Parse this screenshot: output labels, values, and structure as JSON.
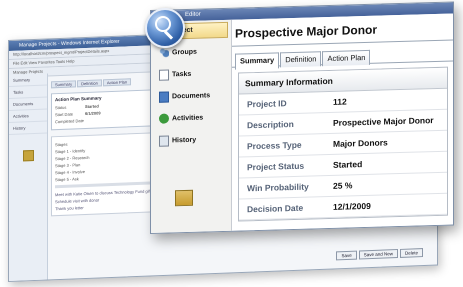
{
  "background_window": {
    "title": "Manage Projects - Windows Internet Explorer",
    "address": "http://localhost/cm/prospect_mgmt/ProjectDetails.aspx",
    "toolbar": "File  Edit  View  Favorites  Tools  Help",
    "tab": "Manage Projects",
    "nav": [
      "Summary",
      "Tasks",
      "Documents",
      "Activities",
      "History"
    ],
    "tabs": [
      "Summary",
      "Definition",
      "Action Plan"
    ],
    "panel_title": "Action Plan Summary",
    "panel_rows": [
      {
        "k": "Status",
        "v": "Started"
      },
      {
        "k": "Start Date",
        "v": "6/1/2009"
      },
      {
        "k": "Completed Date",
        "v": ""
      }
    ],
    "stages_title": "Stages",
    "stages": [
      "Stage 1 - Identify",
      "Stage 2 - Research",
      "Stage 3 - Plan",
      "Stage 4 - Involve",
      "Stage 5 - Ask"
    ],
    "table_rows": [
      "Meet with Katie Olsen to discuss Technology Fund gift",
      "Schedule visit with donor",
      "Thank you letter"
    ],
    "buttons": [
      "Save",
      "Save and New",
      "Delete"
    ]
  },
  "window": {
    "title": "Editor",
    "nav_selected": "Project",
    "nav": [
      {
        "label": "Groups",
        "icon": "groups-icon"
      },
      {
        "label": "Tasks",
        "icon": "tasks-icon"
      },
      {
        "label": "Documents",
        "icon": "documents-icon"
      },
      {
        "label": "Activities",
        "icon": "activities-icon"
      },
      {
        "label": "History",
        "icon": "history-icon"
      }
    ],
    "heading": "Prospective Major Donor",
    "tabs": [
      {
        "label": "Summary",
        "active": true
      },
      {
        "label": "Definition",
        "active": false
      },
      {
        "label": "Action Plan",
        "active": false
      }
    ],
    "summary_title": "Summary Information",
    "fields": [
      {
        "label": "Project ID",
        "value": "112"
      },
      {
        "label": "Description",
        "value": "Prospective Major Donor"
      },
      {
        "label": "Process Type",
        "value": "Major Donors"
      },
      {
        "label": "Project Status",
        "value": "Started"
      },
      {
        "label": "Win Probability",
        "value": "25 %"
      },
      {
        "label": "Decision Date",
        "value": "12/1/2009"
      }
    ]
  },
  "colors": {
    "titlebar": "#45629a",
    "selected_nav": "#f2d98a",
    "label": "#556277"
  }
}
